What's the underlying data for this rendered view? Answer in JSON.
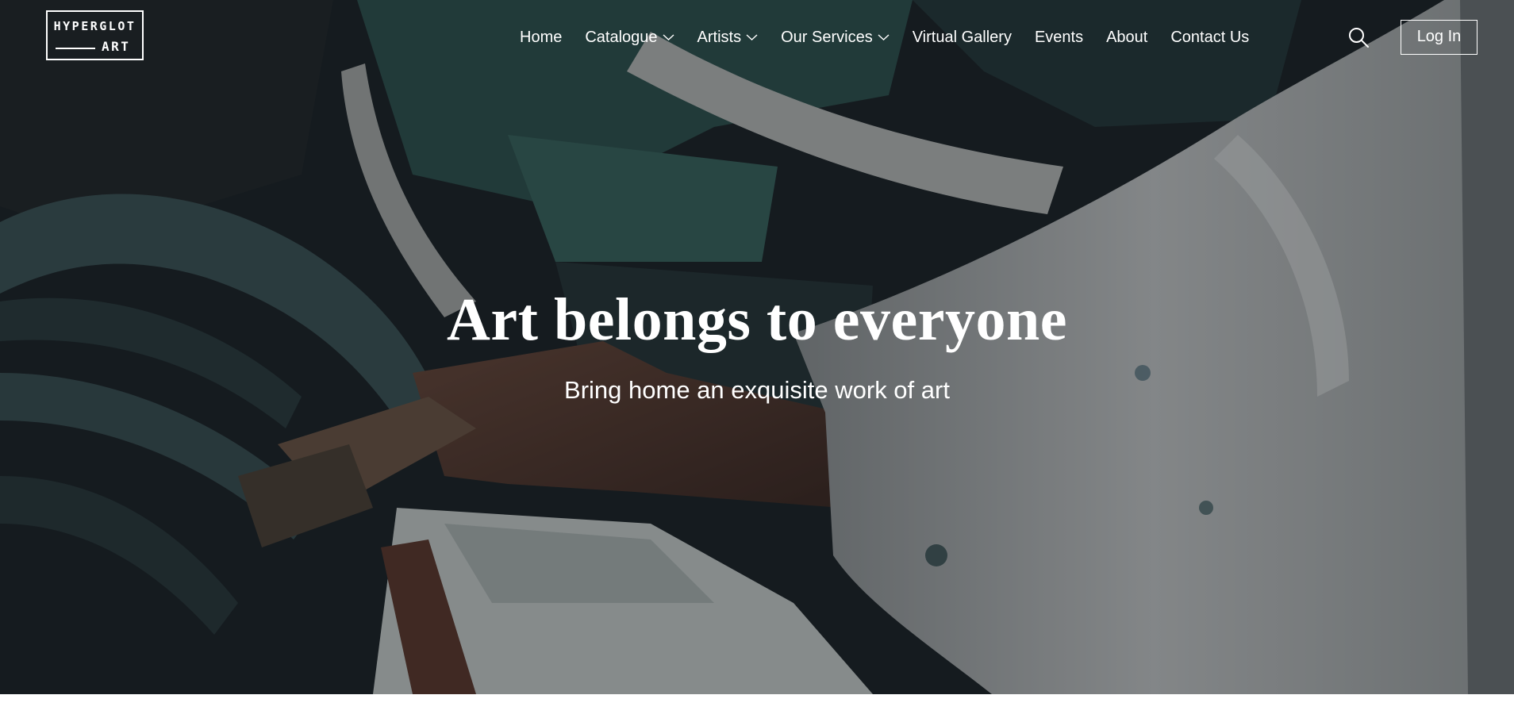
{
  "brand": {
    "logo_top": "HYPERGLOT",
    "logo_bottom": "ART"
  },
  "nav": {
    "items": [
      {
        "label": "Home",
        "dropdown": false
      },
      {
        "label": "Catalogue",
        "dropdown": true
      },
      {
        "label": "Artists",
        "dropdown": true
      },
      {
        "label": "Our Services",
        "dropdown": true
      },
      {
        "label": "Virtual Gallery",
        "dropdown": false
      },
      {
        "label": "Events",
        "dropdown": false
      },
      {
        "label": "About",
        "dropdown": false
      },
      {
        "label": "Contact Us",
        "dropdown": false
      }
    ],
    "search_icon": "search-icon",
    "login_label": "Log In"
  },
  "hero": {
    "title": "Art belongs to everyone",
    "subtitle": "Bring home an exquisite work of art"
  },
  "colors": {
    "text": "#ffffff",
    "hero_dark": "#1b2226",
    "paint_teal": "#2f5450",
    "page_bg": "#ffffff"
  }
}
